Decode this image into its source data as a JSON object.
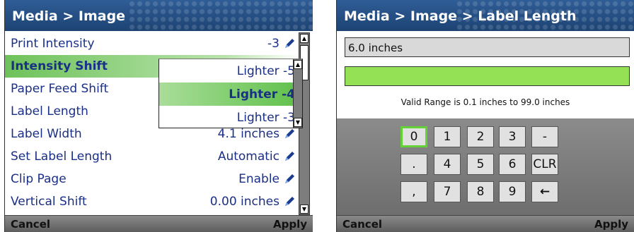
{
  "left_screen": {
    "title": "Media > Image",
    "rows": [
      {
        "label": "Print Intensity",
        "value": "-3"
      },
      {
        "label": "Intensity Shift",
        "value": ""
      },
      {
        "label": "Paper Feed Shift",
        "value": ""
      },
      {
        "label": "Label Length",
        "value": ""
      },
      {
        "label": "Label Width",
        "value": "4.1 inches"
      },
      {
        "label": "Set Label Length",
        "value": "Automatic"
      },
      {
        "label": "Clip Page",
        "value": "Enable"
      },
      {
        "label": "Vertical Shift",
        "value": "0.00 inches"
      }
    ],
    "dropdown_options": [
      "Lighter -5",
      "Lighter -4",
      "Lighter -3"
    ],
    "dropdown_selected": "Lighter -4",
    "softkeys": {
      "left": "Cancel",
      "right": "Apply"
    }
  },
  "right_screen": {
    "title": "Media > Image > Label Length",
    "current_value": "6.0 inches",
    "input_value": "",
    "hint": "Valid Range is 0.1 inches to 99.0 inches",
    "keypad": [
      [
        "0",
        "1",
        "2",
        "3",
        "-"
      ],
      [
        ".",
        "4",
        "5",
        "6",
        "CLR"
      ],
      [
        ",",
        "7",
        "8",
        "9",
        "←"
      ]
    ],
    "focused_key": "0",
    "softkeys": {
      "left": "Cancel",
      "right": "Apply"
    }
  },
  "colors": {
    "title_bar": "#1d4373",
    "selected_row": "#6ec25a",
    "input_green": "#94e156",
    "text_blue": "#1a2f86"
  }
}
